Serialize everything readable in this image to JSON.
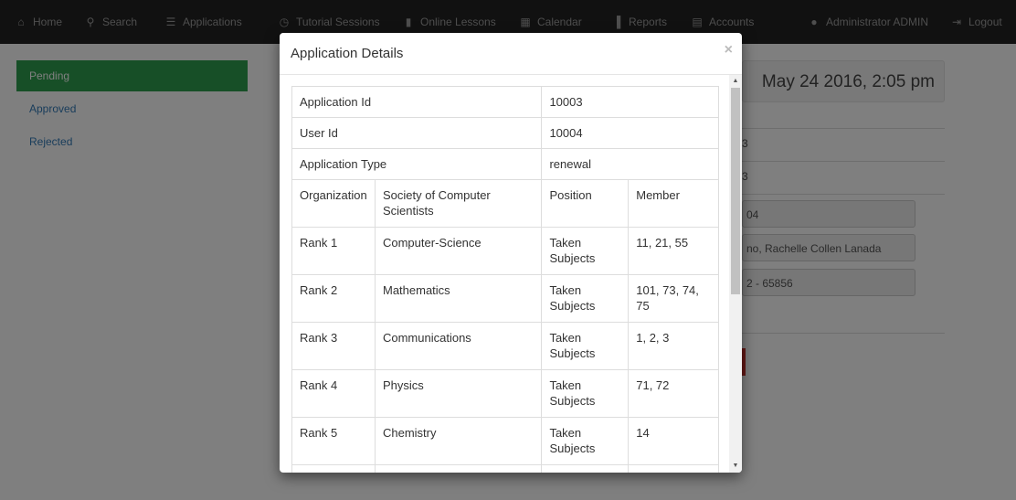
{
  "navbar": {
    "items": [
      {
        "label": "Home",
        "icon": "home-icon"
      },
      {
        "label": "Search",
        "icon": "search-icon"
      },
      {
        "label": "Applications",
        "icon": "list-icon"
      },
      {
        "label": "Tutorial Sessions",
        "icon": "clock-icon"
      },
      {
        "label": "Online Lessons",
        "icon": "book-icon"
      },
      {
        "label": "Calendar",
        "icon": "calendar-icon"
      },
      {
        "label": "Reports",
        "icon": "bar-chart-icon"
      },
      {
        "label": "Accounts",
        "icon": "list-alt-icon"
      }
    ],
    "user": "Administrator ADMIN",
    "logout": "Logout"
  },
  "sidebar": {
    "items": [
      {
        "label": "Pending",
        "active": true
      },
      {
        "label": "Approved",
        "active": false
      },
      {
        "label": "Rejected",
        "active": false
      }
    ]
  },
  "background_panel": {
    "date": "May 24 2016, 2:05 pm",
    "line1": "3",
    "line2": "3",
    "field1": "04",
    "field2": "no, Rachelle Collen Lanada",
    "field3": "2 - 65856"
  },
  "modal": {
    "title": "Application Details",
    "close": "×",
    "info_rows": [
      {
        "label": "Application Id",
        "value": "10003"
      },
      {
        "label": "User Id",
        "value": "10004"
      },
      {
        "label": "Application Type",
        "value": "renewal"
      }
    ],
    "header_row": [
      "Organization",
      "Society of Computer Scientists",
      "Position",
      "Member"
    ],
    "rank_rows": [
      [
        "Rank 1",
        "Computer-Science",
        "Taken Subjects",
        "11, 21, 55"
      ],
      [
        "Rank 2",
        "Mathematics",
        "Taken Subjects",
        "101, 73, 74, 75"
      ],
      [
        "Rank 3",
        "Communications",
        "Taken Subjects",
        "1, 2, 3"
      ],
      [
        "Rank 4",
        "Physics",
        "Taken Subjects",
        "71, 72"
      ],
      [
        "Rank 5",
        "Chemistry",
        "Taken Subjects",
        "14"
      ]
    ]
  },
  "colors": {
    "navbar": "#222222",
    "active_sidebar": "#2e9e4e",
    "link": "#337ab7"
  }
}
